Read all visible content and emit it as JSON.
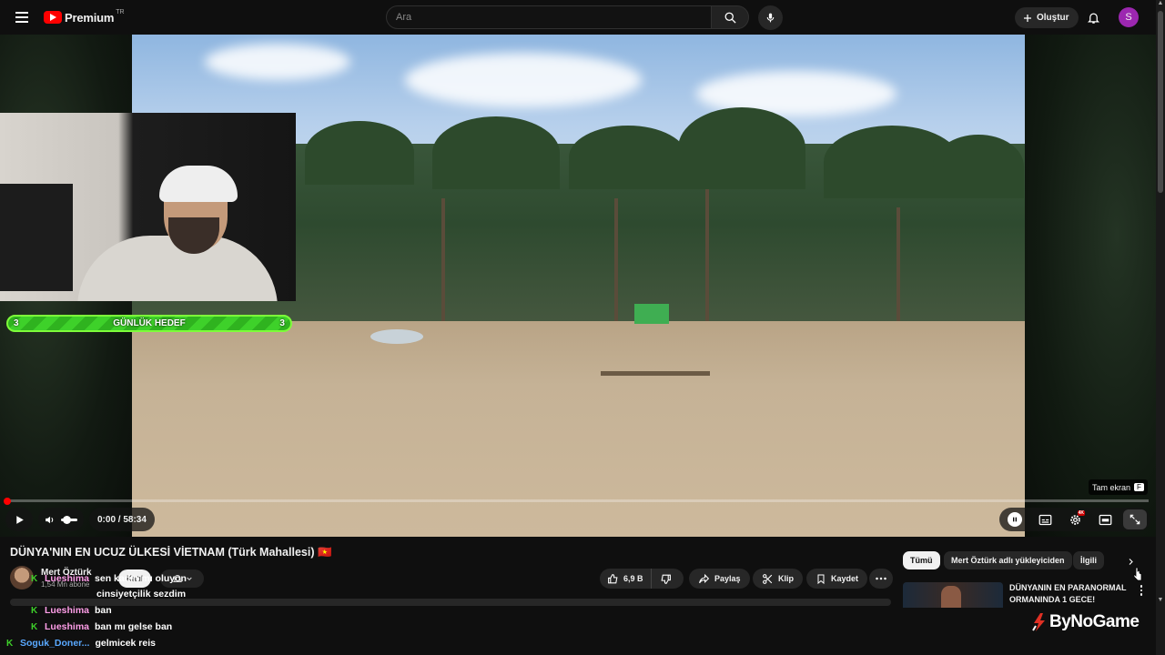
{
  "header": {
    "brand": "Premium",
    "region": "TR",
    "search_placeholder": "Ara",
    "create_label": "Oluştur",
    "avatar_letter": "S"
  },
  "player": {
    "overlay_goal": {
      "left_count": "3",
      "label": "GÜNLÜK HEDEF",
      "right_count": "3"
    },
    "fullscreen_tip": {
      "label": "Tam ekran",
      "key": "F"
    },
    "time": "0:00 / 58:34",
    "progress": 0,
    "hd_badge": "4K"
  },
  "video": {
    "title": "DÜNYA'NIN EN UCUZ ÜLKESİ VİETNAM (Türk Mahallesi) 🇻🇳",
    "channel_name": "Mert Öztürk",
    "subscribers": "1,54 Mn abone",
    "join_label": "Katıl",
    "likes": "6,9 B",
    "share_label": "Paylaş",
    "clip_label": "Klip",
    "save_label": "Kaydet"
  },
  "chat": [
    {
      "user": "Lueshima",
      "user_color": "#ff9ee8",
      "message": "sen kadın mı oluyon"
    },
    {
      "user": "",
      "user_color": "#ffffff",
      "message": "cinsiyetçilik sezdim"
    },
    {
      "user": "Lueshima",
      "user_color": "#ff9ee8",
      "message": "ban"
    },
    {
      "user": "Lueshima",
      "user_color": "#ff9ee8",
      "message": "ban mı gelse ban"
    },
    {
      "user": "Soguk_Doner...",
      "user_color": "#5aa9ff",
      "message": "gelmicek reis"
    }
  ],
  "sidebar": {
    "chips": [
      "Tümü",
      "Mert Öztürk adlı yükleyiciden",
      "İlgili"
    ],
    "active_chip": "Tümü",
    "recommendation": {
      "title": "DÜNYANIN EN PARANORMAL ORMANINDA 1 GECE!"
    }
  },
  "watermark": "ByNoGame",
  "colors": {
    "accent": "#ff0000",
    "goal_green": "#3ed12a",
    "avatar": "#9c27b0"
  }
}
